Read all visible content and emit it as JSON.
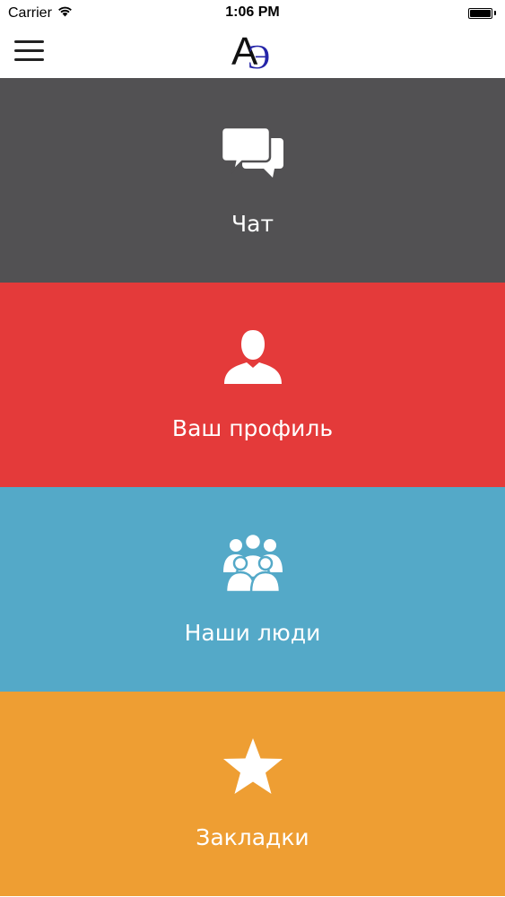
{
  "status_bar": {
    "carrier": "Carrier",
    "time": "1:06 PM",
    "wifi_icon": "wifi-icon",
    "battery_icon": "battery-icon",
    "battery_level": 1.0
  },
  "nav": {
    "menu_icon": "hamburger-menu-icon",
    "logo": {
      "letter_a": "A",
      "letter_e": "Э",
      "color_a": "#111111",
      "color_e": "#2424a8"
    }
  },
  "tiles": [
    {
      "label": "Чат",
      "icon": "chat-bubbles-icon",
      "color": "#525153"
    },
    {
      "label": "Ваш профиль",
      "icon": "user-profile-icon",
      "color": "#e43a3a"
    },
    {
      "label": "Наши люди",
      "icon": "people-group-icon",
      "color": "#54a9c8"
    },
    {
      "label": "Закладки",
      "icon": "star-icon",
      "color": "#ee9e33"
    }
  ]
}
